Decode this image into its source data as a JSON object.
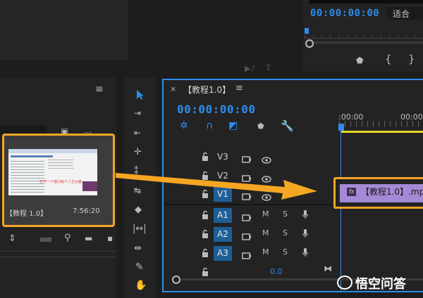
{
  "program_monitor": {
    "timecode": "00:00:00:00",
    "fit": "适合"
  },
  "project_panel": {
    "clip_name": "【教程 1.0】",
    "clip_duration": "7:56:20",
    "thumb_caption": "打开一个窗口给个人主页面"
  },
  "timeline": {
    "tab_label": "【教程1.0】",
    "timecode": "00:00:00:00",
    "ruler_start": ":00:00",
    "ruler_next": "00:00",
    "clip_label": "【教程1.0】.mp",
    "audio_value": "0.0",
    "video_tracks": [
      "V3",
      "V2",
      "V1"
    ],
    "audio_tracks": [
      "A1",
      "A2",
      "A3"
    ],
    "mute_label": "M",
    "solo_label": "S",
    "fx_label": "fx"
  },
  "watermark": {
    "text": "悟空问答"
  },
  "colors": {
    "accent_blue": "#2d8ceb",
    "highlight_orange": "#f5a623",
    "clip_purple": "#a48ad6",
    "selected_track": "#1e5f97"
  }
}
